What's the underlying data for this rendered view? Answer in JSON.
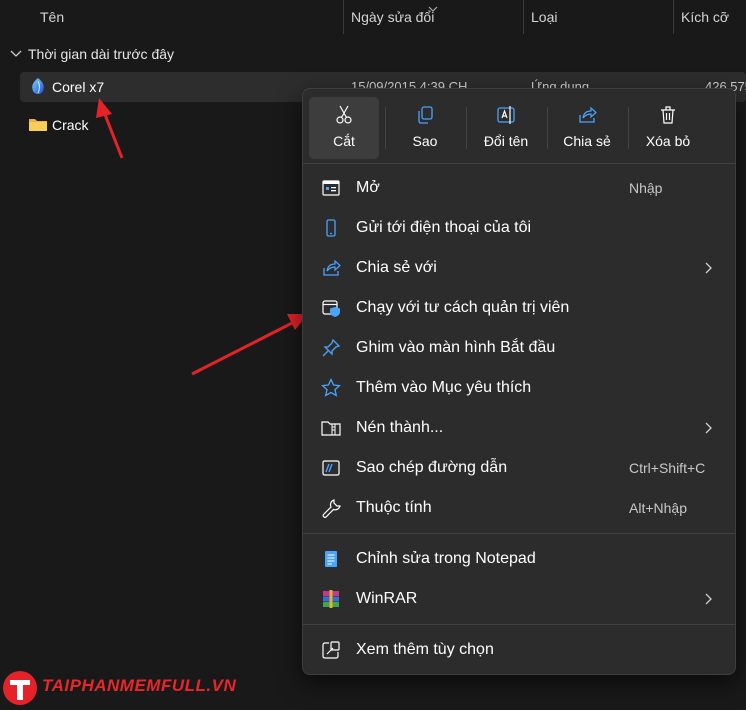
{
  "header": {
    "col_name": "Tên",
    "col_date": "Ngày sửa đổi",
    "col_type": "Loại",
    "col_size": "Kích cỡ"
  },
  "group": {
    "label": "Thời gian dài trước đây"
  },
  "files": [
    {
      "name": "Corel x7",
      "date": "15/09/2015 4:39 CH",
      "type": "Ứng dụng",
      "size": "426.575",
      "icon": "corel-app-icon"
    },
    {
      "name": "Crack",
      "icon": "folder-icon"
    }
  ],
  "menu": {
    "toolbar": [
      {
        "label": "Cắt",
        "icon": "scissors-icon"
      },
      {
        "label": "Sao",
        "icon": "copy-icon"
      },
      {
        "label": "Đổi tên",
        "icon": "rename-icon"
      },
      {
        "label": "Chia sẻ",
        "icon": "share-icon"
      },
      {
        "label": "Xóa bỏ",
        "icon": "trash-icon"
      }
    ],
    "items": [
      {
        "label": "Mở",
        "shortcut": "Nhập",
        "icon": "open-app-icon"
      },
      {
        "label": "Gửi tới điện thoại của tôi",
        "icon": "phone-icon"
      },
      {
        "label": "Chia sẻ với",
        "icon": "share-with-icon",
        "submenu": true
      },
      {
        "label": "Chạy với tư cách quản trị viên",
        "icon": "admin-shield-icon"
      },
      {
        "label": "Ghim vào màn hình Bắt đầu",
        "icon": "pin-icon"
      },
      {
        "label": "Thêm vào Mục yêu thích",
        "icon": "star-icon"
      },
      {
        "label": "Nén thành...",
        "icon": "compress-icon",
        "submenu": true
      },
      {
        "label": "Sao chép đường dẫn",
        "shortcut": "Ctrl+Shift+C",
        "icon": "copy-path-icon"
      },
      {
        "label": "Thuộc tính",
        "shortcut": "Alt+Nhập",
        "icon": "wrench-icon"
      },
      {
        "label": "Chỉnh sửa trong Notepad",
        "icon": "notepad-icon"
      },
      {
        "label": "WinRAR",
        "icon": "winrar-icon",
        "submenu": true
      },
      {
        "label": "Xem thêm tùy chọn",
        "icon": "more-options-icon"
      }
    ]
  },
  "watermark": {
    "text": "TAIPHANMEMFULL.VN"
  },
  "colors": {
    "background": "#191919",
    "menu": "#2c2c2c",
    "accent": "#4aa3ff",
    "arrow": "#e3222a"
  }
}
